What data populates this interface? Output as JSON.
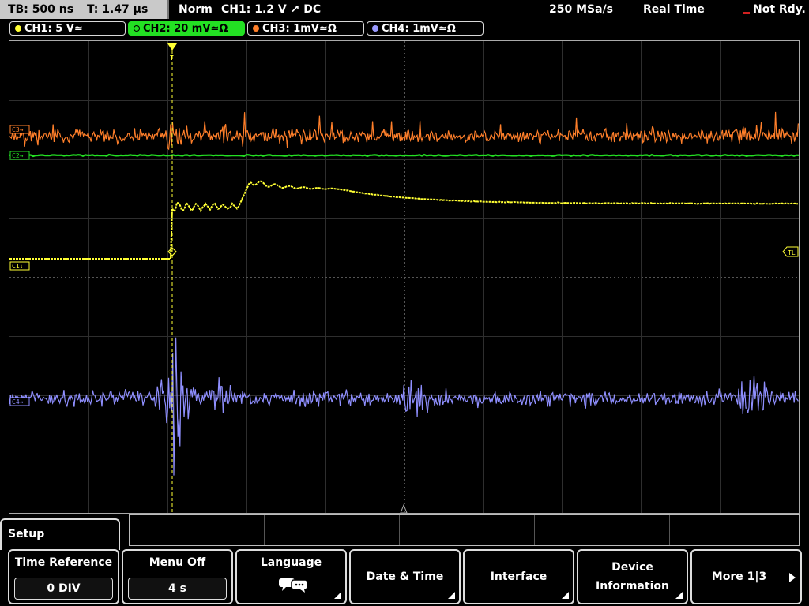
{
  "status_bar": {
    "timebase": "TB: 500 ns",
    "trigger_time": "T: 1.47 µs",
    "trigger_mode": "Norm",
    "trigger_info": "CH1: 1.2 V ↗ DC",
    "sample_rate": "250 MSa/s",
    "acq_mode": "Real Time",
    "status": "Not Rdy."
  },
  "channels": [
    {
      "label": "CH1: 5 V≃",
      "color": "#ffff33",
      "active": false
    },
    {
      "label": "CH2: 20 mV≃Ω",
      "color": "#23e023",
      "active": true
    },
    {
      "label": "CH3: 1mV≃Ω",
      "color": "#ff7f2a",
      "active": false
    },
    {
      "label": "CH4: 1mV≃Ω",
      "color": "#9a9aff",
      "active": false
    }
  ],
  "markers": {
    "c3": "C3→",
    "c2": "C2→",
    "c1": "C1↓",
    "c4": "C4→",
    "trigger_level": "TL",
    "trigger_pos": "T"
  },
  "menu": {
    "title": "Setup",
    "softkeys": [
      {
        "label": "Time Reference",
        "value": "0 DIV"
      },
      {
        "label": "Menu Off",
        "value": "4 s"
      },
      {
        "label": "Language",
        "icon": "speech-bubbles-icon"
      },
      {
        "label": "Date & Time"
      },
      {
        "label": "Interface"
      },
      {
        "label": "Device Information"
      },
      {
        "label": "More 1|3"
      }
    ]
  }
}
